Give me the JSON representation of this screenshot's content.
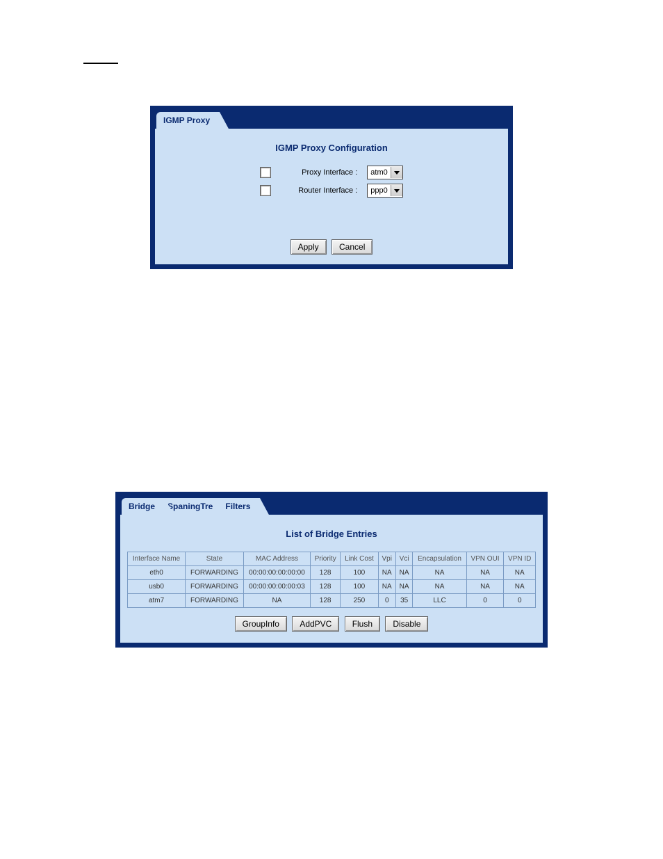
{
  "panel1": {
    "tab": "IGMP Proxy",
    "title": "IGMP Proxy Configuration",
    "rows": [
      {
        "label": "Proxy Interface :",
        "value": "atm0"
      },
      {
        "label": "Router Interface :",
        "value": "ppp0"
      }
    ],
    "buttons": {
      "apply": "Apply",
      "cancel": "Cancel"
    }
  },
  "panel2": {
    "tabs": [
      "Bridge",
      "SpaningTre",
      "Filters"
    ],
    "title": "List of Bridge Entries",
    "headers": [
      "Interface Name",
      "State",
      "MAC Address",
      "Priority",
      "Link Cost",
      "Vpi",
      "Vci",
      "Encapsulation",
      "VPN OUI",
      "VPN ID"
    ],
    "rows": [
      [
        "eth0",
        "FORWARDING",
        "00:00:00:00:00:00",
        "128",
        "100",
        "NA",
        "NA",
        "NA",
        "NA",
        "NA"
      ],
      [
        "usb0",
        "FORWARDING",
        "00:00:00:00:00:03",
        "128",
        "100",
        "NA",
        "NA",
        "NA",
        "NA",
        "NA"
      ],
      [
        "atm7",
        "FORWARDING",
        "NA",
        "128",
        "250",
        "0",
        "35",
        "LLC",
        "0",
        "0"
      ]
    ],
    "buttons": {
      "groupinfo": "GroupInfo",
      "addpvc": "AddPVC",
      "flush": "Flush",
      "disable": "Disable"
    }
  }
}
